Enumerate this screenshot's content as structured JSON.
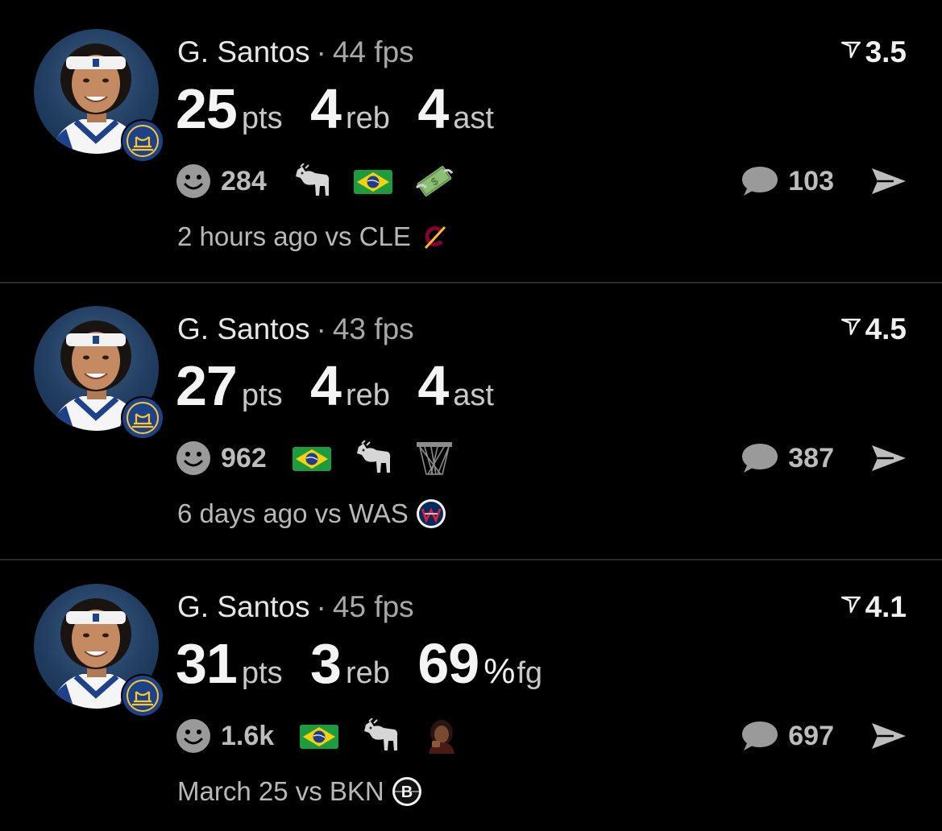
{
  "posts": [
    {
      "player": "G. Santos",
      "fps": "44 fps",
      "rating": "3.5",
      "stats": [
        {
          "value": "25",
          "unit": "pts"
        },
        {
          "value": "4",
          "unit": "reb"
        },
        {
          "value": "4",
          "unit": "ast"
        }
      ],
      "reactions_count": "284",
      "reaction_emojis": [
        "goat-icon",
        "brazil-flag-icon",
        "money-icon"
      ],
      "comments_count": "103",
      "time": "2 hours ago vs CLE",
      "opponent_logo": "cavaliers-logo"
    },
    {
      "player": "G. Santos",
      "fps": "43 fps",
      "rating": "4.5",
      "stats": [
        {
          "value": "27",
          "unit": "pts"
        },
        {
          "value": "4",
          "unit": "reb"
        },
        {
          "value": "4",
          "unit": "ast"
        }
      ],
      "reactions_count": "962",
      "reaction_emojis": [
        "brazil-flag-icon",
        "goat-icon",
        "basket-net-icon"
      ],
      "comments_count": "387",
      "time": "6 days ago vs WAS",
      "opponent_logo": "wizards-logo"
    },
    {
      "player": "G. Santos",
      "fps": "45 fps",
      "rating": "4.1",
      "stats": [
        {
          "value": "31",
          "unit": "pts"
        },
        {
          "value": "3",
          "unit": "reb"
        },
        {
          "value": "69",
          "pct": "%",
          "unit": "fg"
        }
      ],
      "reactions_count": "1.6k",
      "reaction_emojis": [
        "brazil-flag-icon",
        "goat-icon",
        "person-emoji-icon"
      ],
      "comments_count": "697",
      "time": "March 25 vs BKN",
      "opponent_logo": "nets-logo"
    }
  ],
  "colors": {
    "background": "#000000",
    "divider": "#2c2c2c",
    "team_blue": "#1d428a",
    "team_gold": "#ffc72c"
  }
}
